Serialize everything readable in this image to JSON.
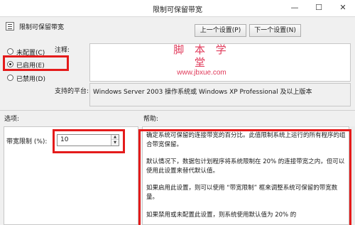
{
  "window": {
    "title": "限制可保留带宽",
    "minimize": "—",
    "maximize": "☐",
    "close": "✕"
  },
  "header": {
    "policy_name": "限制可保留带宽",
    "policy_icon": "policy-settings-icon",
    "prev_button": "上一个设置(P)",
    "next_button": "下一个设置(N)"
  },
  "state": {
    "options": [
      {
        "label": "未配置(C)",
        "selected": false
      },
      {
        "label": "已启用(E)",
        "selected": true
      },
      {
        "label": "已禁用(D)",
        "selected": false
      }
    ]
  },
  "comment": {
    "label": "注释:",
    "value": ""
  },
  "platform": {
    "label": "支持的平台:",
    "value": "Windows Server 2003 操作系统或 Windows XP Professional 及以上版本"
  },
  "watermark": {
    "text": "脚 本 学 堂",
    "url": "www.jbxue.com",
    "color": "#e03a5a"
  },
  "sections": {
    "options": "选项:",
    "help": "帮助:"
  },
  "options_panel": {
    "field_label": "带宽限制 (%):",
    "value": "10"
  },
  "help": {
    "paragraphs": [
      "确定系统可保留的连接带宽的百分比。此值限制系统上运行的所有程序的组合带宽保留。",
      "默认情况下，数据包计划程序将系统限制在 20% 的连接带宽之内，但可以使用此设置来替代默认值。",
      "如果启用此设置，则可以使用 “带宽限制” 框来调整系统可保留的带宽数量。",
      "如果禁用或未配置此设置，则系统使用默认值为 20% 的"
    ]
  },
  "highlight_color": "#e41b1b"
}
